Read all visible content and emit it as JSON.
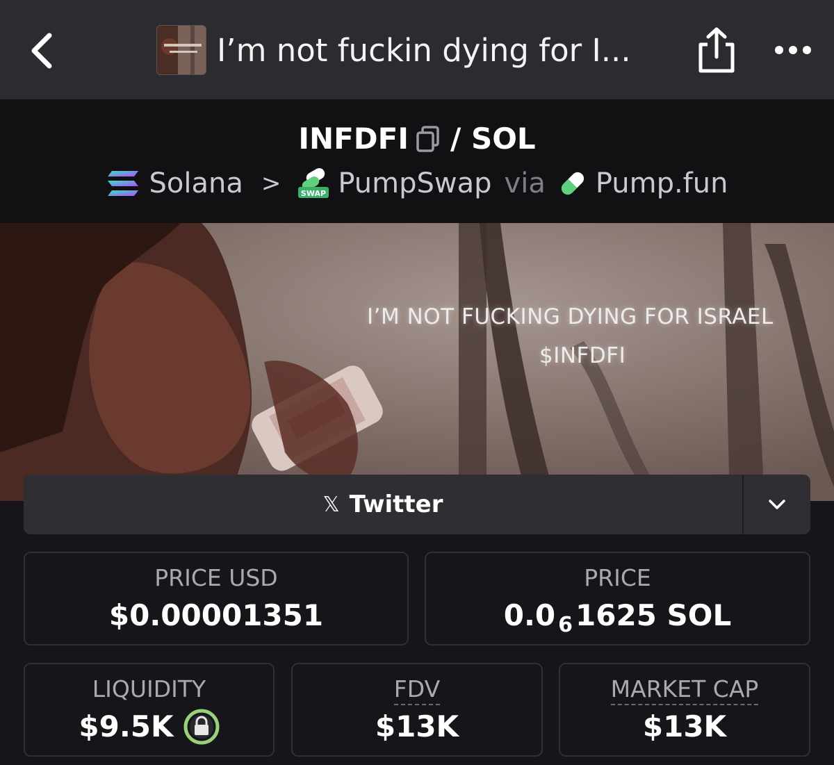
{
  "nav": {
    "title": "I’m not fuckin dying for I...",
    "back_icon": "chevron-left-icon",
    "share_icon": "share-icon",
    "more_icon": "more-dots-icon"
  },
  "pair": {
    "base": "INFDFI",
    "separator": "/ SOL",
    "chain": "Solana",
    "dex": "PumpSwap",
    "via": "via",
    "launchpad": "Pump.fun",
    "swap_badge": "SWAP"
  },
  "banner": {
    "line1": "I’M NOT FUCKING DYING FOR ISRAEL",
    "line2": "$INFDFI"
  },
  "social": {
    "label": "Twitter",
    "icon": "x-logo-icon"
  },
  "stats": {
    "price_usd_label": "PRICE USD",
    "price_usd_value": "$0.00001351",
    "price_label": "PRICE",
    "price_prefix": "0.0",
    "price_zeros": "6",
    "price_suffix": "1625 SOL",
    "liquidity_label": "LIQUIDITY",
    "liquidity_value": "$9.5K",
    "fdv_label": "FDV",
    "fdv_value": "$13K",
    "mcap_label": "MARKET CAP",
    "mcap_value": "$13K"
  },
  "colors": {
    "topbar": "#2b2b30",
    "header": "#111114",
    "background": "#16161a",
    "lock_green": "#9ad07a"
  }
}
